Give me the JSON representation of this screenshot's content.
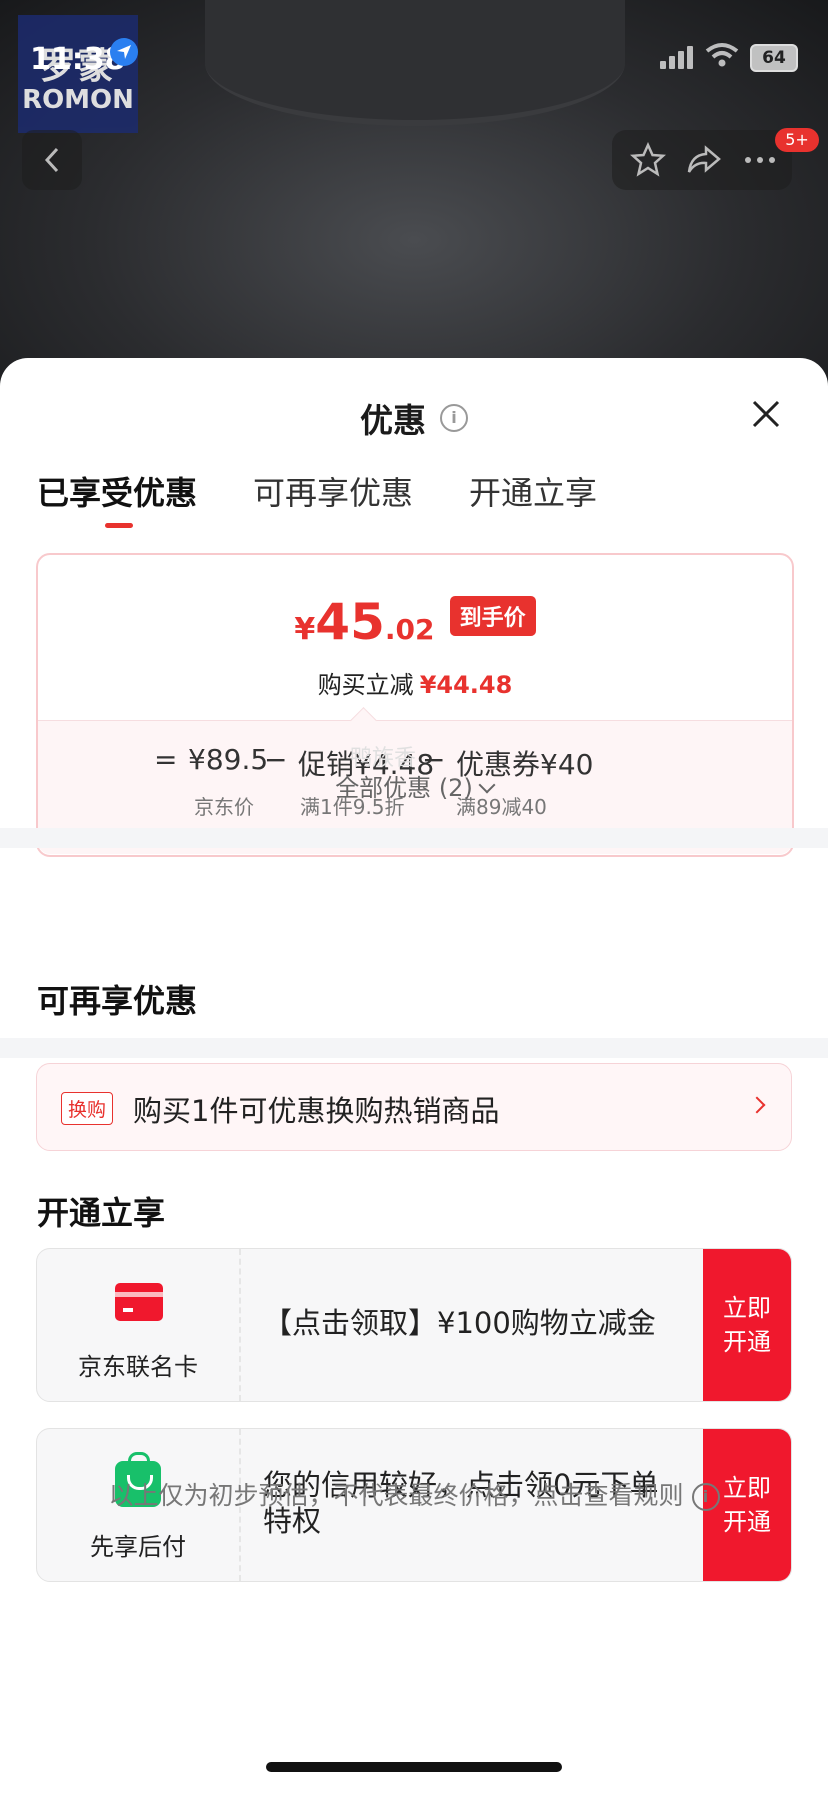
{
  "status_bar": {
    "time": "11:38",
    "battery": "64"
  },
  "brand": {
    "cn": "罗蒙",
    "en": "ROMON"
  },
  "notifications": {
    "badge": "5+"
  },
  "sheet": {
    "title": "优惠",
    "tabs": [
      "已享受优惠",
      "可再享优惠",
      "开通立享"
    ],
    "active_tab": 0,
    "price": {
      "currency": "¥",
      "integer": "45",
      "decimal": ".02",
      "tag": "到手价",
      "instant_label": "购买立减",
      "instant_amount": "¥44.48"
    },
    "breakdown": {
      "equals": "=",
      "jd_price": "¥89.5",
      "jd_price_label": "京东价",
      "minus": "−",
      "promo": "促销¥4.48",
      "promo_label": "满1件9.5折",
      "coupon": "优惠券¥40",
      "coupon_label": "满89减40"
    },
    "watermark": "鸭族香",
    "all_offers": "全部优惠 (2)",
    "more_section": {
      "title": "可再享优惠",
      "swap_tag": "换购",
      "swap_text": "购买1件可优惠换购热销商品"
    },
    "open_section": {
      "title": "开通立享",
      "cards": [
        {
          "label": "京东联名卡",
          "desc": "【点击领取】¥100购物立减金",
          "button": "立即\n开通",
          "icon": "credit-card-icon"
        },
        {
          "label": "先享后付",
          "desc": "您的信用较好，点击领0元下单特权",
          "button": "立即\n开通",
          "icon": "shopping-bag-icon"
        }
      ]
    },
    "disclaimer": "以上仅为初步预估，不代表最终价格，点击查看规则"
  },
  "colors": {
    "accent": "#e8322e",
    "button": "#f0182d",
    "green": "#18c06a"
  }
}
